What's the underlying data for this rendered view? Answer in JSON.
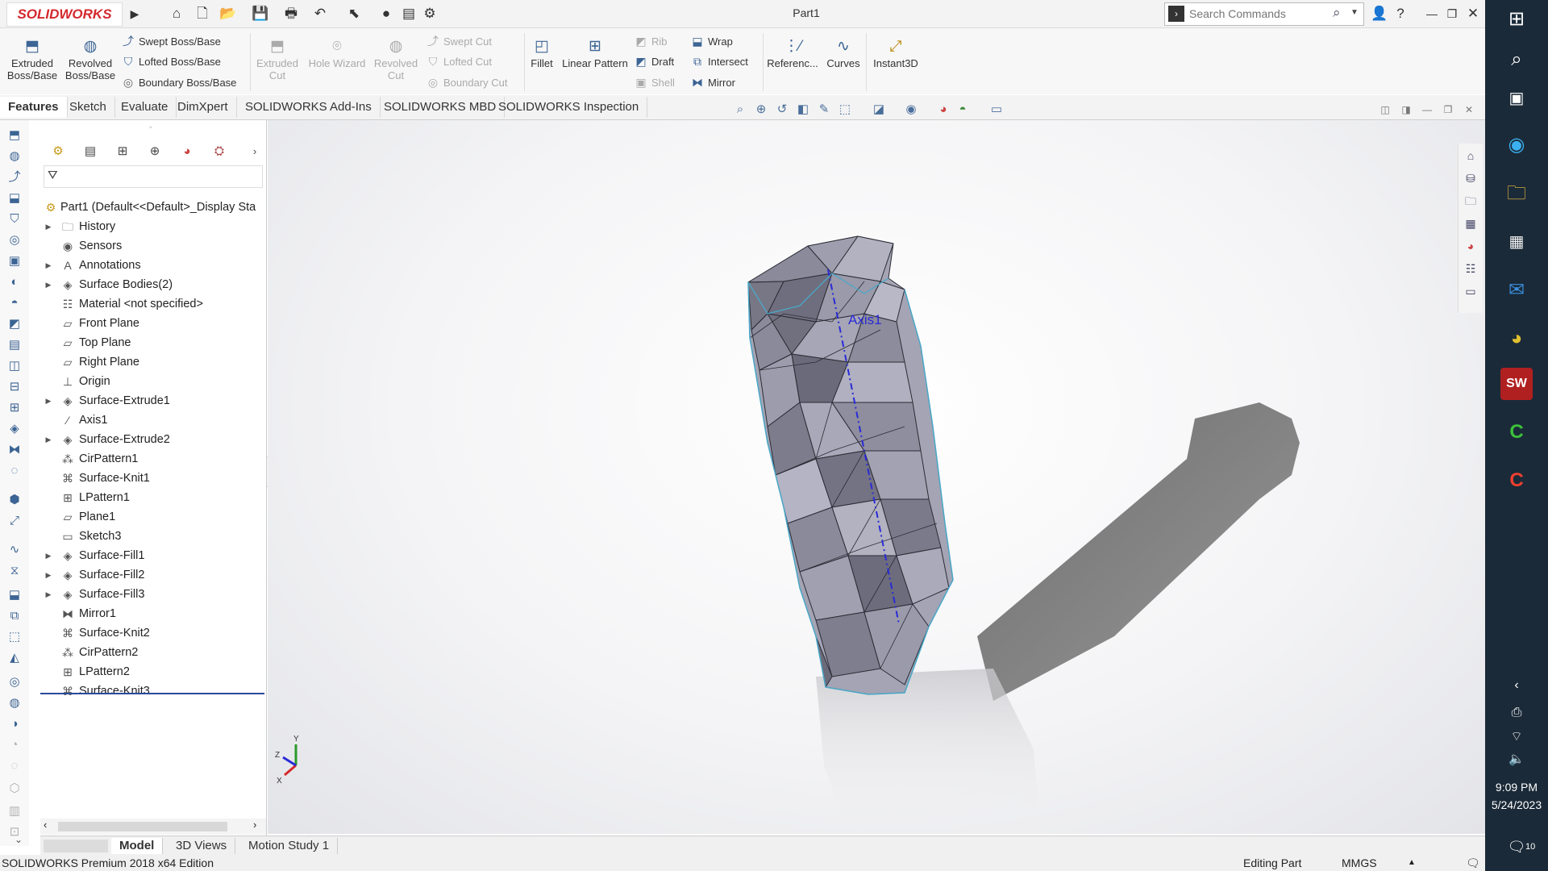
{
  "app": {
    "name": "SOLIDWORKS",
    "document_title": "Part1"
  },
  "search": {
    "placeholder": "Search Commands"
  },
  "quick_access": [
    {
      "icon": "home-icon",
      "glyph": "⌂"
    },
    {
      "icon": "new-document-icon",
      "glyph": "🗋"
    },
    {
      "icon": "open-folder-icon",
      "glyph": "📂"
    },
    {
      "icon": "save-icon",
      "glyph": "💾"
    },
    {
      "icon": "print-icon",
      "glyph": "🖶"
    },
    {
      "icon": "undo-icon",
      "glyph": "↶"
    },
    {
      "icon": "select-pointer-icon",
      "glyph": "⬉"
    },
    {
      "icon": "rebuild-icon",
      "glyph": "●"
    },
    {
      "icon": "file-properties-icon",
      "glyph": "▤"
    },
    {
      "icon": "options-gear-icon",
      "glyph": "⚙"
    }
  ],
  "command_manager": {
    "extruded_boss": "Extruded Boss/Base",
    "revolved_boss": "Revolved Boss/Base",
    "swept_boss": "Swept Boss/Base",
    "lofted_boss": "Lofted Boss/Base",
    "boundary_boss": "Boundary Boss/Base",
    "extruded_cut": "Extruded Cut",
    "hole_wizard": "Hole Wizard",
    "revolved_cut": "Revolved Cut",
    "swept_cut": "Swept Cut",
    "lofted_cut": "Lofted Cut",
    "boundary_cut": "Boundary Cut",
    "fillet": "Fillet",
    "linear_pattern": "Linear Pattern",
    "rib": "Rib",
    "draft": "Draft",
    "shell": "Shell",
    "wrap": "Wrap",
    "intersect": "Intersect",
    "mirror": "Mirror",
    "reference": "Referenc...",
    "curves": "Curves",
    "instant3d": "Instant3D"
  },
  "tabs": [
    "Features",
    "Sketch",
    "Evaluate",
    "DimXpert",
    "SOLIDWORKS Add-Ins",
    "SOLIDWORKS MBD",
    "SOLIDWORKS Inspection"
  ],
  "feature_tree": {
    "root": "Part1  (Default<<Default>_Display Sta",
    "items": [
      {
        "label": "History",
        "icon": "history-folder-icon",
        "glyph": "🗀",
        "expandable": true
      },
      {
        "label": "Sensors",
        "icon": "sensors-icon",
        "glyph": "◉",
        "expandable": false
      },
      {
        "label": "Annotations",
        "icon": "annotations-icon",
        "glyph": "A",
        "expandable": true
      },
      {
        "label": "Surface Bodies(2)",
        "icon": "surface-bodies-icon",
        "glyph": "◈",
        "expandable": true
      },
      {
        "label": "Material <not specified>",
        "icon": "material-icon",
        "glyph": "☷",
        "expandable": false
      },
      {
        "label": "Front Plane",
        "icon": "plane-icon",
        "glyph": "▱",
        "expandable": false
      },
      {
        "label": "Top Plane",
        "icon": "plane-icon",
        "glyph": "▱",
        "expandable": false
      },
      {
        "label": "Right Plane",
        "icon": "plane-icon",
        "glyph": "▱",
        "expandable": false
      },
      {
        "label": "Origin",
        "icon": "origin-icon",
        "glyph": "⊥",
        "expandable": false
      },
      {
        "label": "Surface-Extrude1",
        "icon": "surface-extrude-icon",
        "glyph": "◈",
        "expandable": true
      },
      {
        "label": "Axis1",
        "icon": "axis-icon",
        "glyph": "⁄",
        "expandable": false
      },
      {
        "label": "Surface-Extrude2",
        "icon": "surface-extrude-icon",
        "glyph": "◈",
        "expandable": true
      },
      {
        "label": "CirPattern1",
        "icon": "circular-pattern-icon",
        "glyph": "⁂",
        "expandable": false
      },
      {
        "label": "Surface-Knit1",
        "icon": "surface-knit-icon",
        "glyph": "⌘",
        "expandable": false
      },
      {
        "label": "LPattern1",
        "icon": "linear-pattern-icon",
        "glyph": "⊞",
        "expandable": false
      },
      {
        "label": "Plane1",
        "icon": "plane-icon",
        "glyph": "▱",
        "expandable": false
      },
      {
        "label": "Sketch3",
        "icon": "sketch-icon",
        "glyph": "▭",
        "expandable": false
      },
      {
        "label": "Surface-Fill1",
        "icon": "surface-fill-icon",
        "glyph": "◈",
        "expandable": true
      },
      {
        "label": "Surface-Fill2",
        "icon": "surface-fill-icon",
        "glyph": "◈",
        "expandable": true
      },
      {
        "label": "Surface-Fill3",
        "icon": "surface-fill-icon",
        "glyph": "◈",
        "expandable": true
      },
      {
        "label": "Mirror1",
        "icon": "mirror-icon",
        "glyph": "⧓",
        "expandable": false
      },
      {
        "label": "Surface-Knit2",
        "icon": "surface-knit-icon",
        "glyph": "⌘",
        "expandable": false
      },
      {
        "label": "CirPattern2",
        "icon": "circular-pattern-icon",
        "glyph": "⁂",
        "expandable": false
      },
      {
        "label": "LPattern2",
        "icon": "linear-pattern-icon",
        "glyph": "⊞",
        "expandable": false
      },
      {
        "label": "Surface-Knit3",
        "icon": "surface-knit-icon",
        "glyph": "⌘",
        "expandable": false
      }
    ]
  },
  "viewport": {
    "axis_label": "Axis1",
    "triad": {
      "x": "X",
      "y": "Y",
      "z": "Z"
    }
  },
  "bottom_tabs": [
    "Model",
    "3D Views",
    "Motion Study 1"
  ],
  "status": {
    "edition": "SOLIDWORKS Premium 2018 x64 Edition",
    "mode": "Editing Part",
    "units": "MMGS"
  },
  "taskbar": {
    "time": "9:09 PM",
    "date": "5/24/2023",
    "notifications": "10"
  },
  "colors": {
    "brand": "#d4282e",
    "axis": "#2a2ad8",
    "taskbar": "#1b2a38"
  }
}
